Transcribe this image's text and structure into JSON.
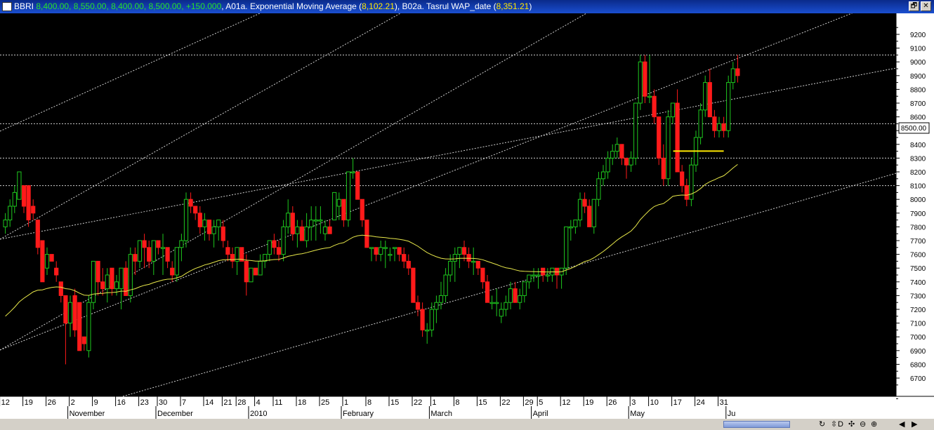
{
  "window": {
    "title_parts": [
      {
        "text": "BBRI",
        "color": "#ffffff"
      },
      {
        "text": " 8,400.00, 8,550.00, 8,400.00, 8,500.00, +150.000",
        "color": "#27e027"
      },
      {
        "text": ", A01a. Exponential Moving Average (",
        "color": "#ffffff"
      },
      {
        "text": "8,102.21",
        "color": "#ffe800"
      },
      {
        "text": "), B02a. Tasrul WAP_date (",
        "color": "#ffffff"
      },
      {
        "text": "8,351.21",
        "color": "#ffe800"
      },
      {
        "text": ")",
        "color": "#ffffff"
      }
    ],
    "buttons": [
      "🗗",
      "✕"
    ]
  },
  "toolbar": {
    "icons": [
      "refresh-icon",
      "resize-icon",
      "d-icon",
      "move-icon",
      "zoom-out-icon",
      "zoom-in-icon",
      "scroll-left-icon",
      "scroll-right-icon"
    ],
    "glyphs": [
      "↻",
      "⇳",
      "D",
      "✣",
      "⊖",
      "⊕",
      "◀",
      "▶"
    ]
  },
  "chart_data": {
    "type": "candlestick",
    "ticker": "BBRI",
    "ylim": [
      6500,
      9350
    ],
    "yticks": [
      6700,
      6800,
      6900,
      7000,
      7100,
      7200,
      7300,
      7400,
      7500,
      7600,
      7700,
      7800,
      7900,
      8000,
      8100,
      8200,
      8300,
      8400,
      8500,
      8600,
      8700,
      8800,
      8900,
      9000,
      9100,
      9200
    ],
    "last_price": "8500.00",
    "x_day_labels": [
      {
        "i": 0,
        "t": "12"
      },
      {
        "i": 5,
        "t": "19"
      },
      {
        "i": 10,
        "t": "26"
      },
      {
        "i": 15,
        "t": "2"
      },
      {
        "i": 20,
        "t": "9"
      },
      {
        "i": 25,
        "t": "16"
      },
      {
        "i": 30,
        "t": "23"
      },
      {
        "i": 34,
        "t": "30"
      },
      {
        "i": 39,
        "t": "7"
      },
      {
        "i": 44,
        "t": "14"
      },
      {
        "i": 48,
        "t": "21"
      },
      {
        "i": 51,
        "t": "28"
      },
      {
        "i": 55,
        "t": "4"
      },
      {
        "i": 59,
        "t": "11"
      },
      {
        "i": 64,
        "t": "18"
      },
      {
        "i": 69,
        "t": "25"
      },
      {
        "i": 74,
        "t": "1"
      },
      {
        "i": 79,
        "t": "8"
      },
      {
        "i": 84,
        "t": "15"
      },
      {
        "i": 89,
        "t": "22"
      },
      {
        "i": 93,
        "t": "1"
      },
      {
        "i": 98,
        "t": "8"
      },
      {
        "i": 103,
        "t": "15"
      },
      {
        "i": 108,
        "t": "22"
      },
      {
        "i": 113,
        "t": "29"
      },
      {
        "i": 116,
        "t": "5"
      },
      {
        "i": 121,
        "t": "12"
      },
      {
        "i": 126,
        "t": "19"
      },
      {
        "i": 131,
        "t": "26"
      },
      {
        "i": 136,
        "t": "3"
      },
      {
        "i": 140,
        "t": "10"
      },
      {
        "i": 145,
        "t": "17"
      },
      {
        "i": 150,
        "t": "24"
      },
      {
        "i": 155,
        "t": "31"
      }
    ],
    "x_month_labels": [
      {
        "i": 15,
        "t": "November"
      },
      {
        "i": 34,
        "t": "December"
      },
      {
        "i": 54,
        "t": "2010"
      },
      {
        "i": 74,
        "t": "February"
      },
      {
        "i": 93,
        "t": "March"
      },
      {
        "i": 115,
        "t": "April"
      },
      {
        "i": 136,
        "t": "May"
      },
      {
        "i": 157,
        "t": "Ju"
      }
    ],
    "candles": [
      [
        7800,
        7900,
        7750,
        7850
      ],
      [
        7850,
        8000,
        7800,
        7950
      ],
      [
        7950,
        8100,
        7900,
        8050
      ],
      [
        8000,
        8200,
        8000,
        8200
      ],
      [
        8100,
        8100,
        7900,
        7950
      ],
      [
        8100,
        8100,
        7800,
        7850
      ],
      [
        7950,
        8000,
        7850,
        7900
      ],
      [
        7850,
        7850,
        7600,
        7650
      ],
      [
        7700,
        7700,
        7400,
        7400
      ],
      [
        7500,
        7650,
        7450,
        7600
      ],
      [
        7600,
        7600,
        7550,
        7550
      ],
      [
        7500,
        7550,
        7400,
        7450
      ],
      [
        7400,
        7400,
        7250,
        7300
      ],
      [
        7300,
        7300,
        6800,
        7100
      ],
      [
        7100,
        7300,
        7000,
        7250
      ],
      [
        7300,
        7350,
        7000,
        7050
      ],
      [
        7250,
        7250,
        6900,
        6900
      ],
      [
        7000,
        7000,
        6900,
        6950
      ],
      [
        6900,
        7300,
        6850,
        7250
      ],
      [
        7250,
        7550,
        7200,
        7550
      ],
      [
        7550,
        7550,
        7300,
        7400
      ],
      [
        7400,
        7500,
        7300,
        7350
      ],
      [
        7350,
        7500,
        7250,
        7450
      ],
      [
        7500,
        7500,
        7300,
        7350
      ],
      [
        7350,
        7450,
        7300,
        7400
      ],
      [
        7350,
        7500,
        7200,
        7500
      ],
      [
        7500,
        7550,
        7300,
        7300
      ],
      [
        7300,
        7650,
        7250,
        7600
      ],
      [
        7600,
        7650,
        7450,
        7550
      ],
      [
        7550,
        7700,
        7500,
        7700
      ],
      [
        7700,
        7750,
        7500,
        7650
      ],
      [
        7650,
        7700,
        7500,
        7550
      ],
      [
        7550,
        7700,
        7450,
        7700
      ],
      [
        7700,
        7700,
        7600,
        7650
      ],
      [
        7650,
        7750,
        7450,
        7650
      ],
      [
        7650,
        7650,
        7500,
        7550
      ],
      [
        7500,
        7550,
        7400,
        7450
      ],
      [
        7450,
        7650,
        7400,
        7650
      ],
      [
        7650,
        7750,
        7550,
        7700
      ],
      [
        7700,
        8050,
        7650,
        8000
      ],
      [
        8000,
        8050,
        7900,
        7950
      ],
      [
        7950,
        7950,
        7850,
        7900
      ],
      [
        7900,
        7950,
        7750,
        7800
      ],
      [
        7800,
        7900,
        7700,
        7850
      ],
      [
        7850,
        7850,
        7700,
        7750
      ],
      [
        7750,
        7850,
        7650,
        7800
      ],
      [
        7800,
        7850,
        7700,
        7850
      ],
      [
        7800,
        7850,
        7650,
        7700
      ],
      [
        7650,
        7700,
        7550,
        7600
      ],
      [
        7600,
        7650,
        7500,
        7550
      ],
      [
        7550,
        7650,
        7450,
        7650
      ],
      [
        7650,
        7650,
        7550,
        7550
      ],
      [
        7550,
        7600,
        7300,
        7400
      ],
      [
        7400,
        7500,
        7400,
        7500
      ],
      [
        7500,
        7500,
        7450,
        7450
      ],
      [
        7450,
        7600,
        7450,
        7550
      ],
      [
        7550,
        7600,
        7500,
        7600
      ],
      [
        7600,
        7700,
        7550,
        7700
      ],
      [
        7700,
        7750,
        7600,
        7650
      ],
      [
        7650,
        7700,
        7550,
        7600
      ],
      [
        7600,
        7850,
        7550,
        7800
      ],
      [
        7800,
        8000,
        7750,
        7900
      ],
      [
        7900,
        7950,
        7700,
        7750
      ],
      [
        7750,
        7850,
        7650,
        7800
      ],
      [
        7800,
        7850,
        7700,
        7700
      ],
      [
        7700,
        7900,
        7650,
        7800
      ],
      [
        7800,
        7950,
        7700,
        7850
      ],
      [
        7850,
        7950,
        7700,
        7850
      ],
      [
        7850,
        7950,
        7750,
        7850
      ],
      [
        7750,
        7850,
        7700,
        7800
      ],
      [
        7800,
        7850,
        7750,
        7750
      ],
      [
        7850,
        8050,
        7850,
        8050
      ],
      [
        7950,
        8050,
        7850,
        8000
      ],
      [
        8000,
        8000,
        7800,
        7850
      ],
      [
        7850,
        8200,
        7800,
        8200
      ],
      [
        8200,
        8300,
        8150,
        8200
      ],
      [
        8200,
        8200,
        8000,
        8000
      ],
      [
        8000,
        8000,
        7800,
        7850
      ],
      [
        7850,
        7850,
        7650,
        7650
      ],
      [
        7650,
        7650,
        7550,
        7650
      ],
      [
        7650,
        7650,
        7550,
        7600
      ],
      [
        7600,
        7700,
        7550,
        7650
      ],
      [
        7650,
        7700,
        7500,
        7650
      ],
      [
        7600,
        7650,
        7550,
        7600
      ],
      [
        7650,
        7650,
        7550,
        7650
      ],
      [
        7650,
        7650,
        7550,
        7600
      ],
      [
        7600,
        7650,
        7500,
        7550
      ],
      [
        7550,
        7600,
        7450,
        7500
      ],
      [
        7500,
        7500,
        7300,
        7250
      ],
      [
        7250,
        7300,
        7150,
        7200
      ],
      [
        7200,
        7250,
        7000,
        7050
      ],
      [
        7050,
        7100,
        6950,
        7050
      ],
      [
        7050,
        7250,
        7000,
        7200
      ],
      [
        7200,
        7300,
        7100,
        7250
      ],
      [
        7250,
        7400,
        7200,
        7300
      ],
      [
        7300,
        7500,
        7250,
        7450
      ],
      [
        7450,
        7600,
        7400,
        7550
      ],
      [
        7550,
        7650,
        7400,
        7600
      ],
      [
        7600,
        7650,
        7500,
        7650
      ],
      [
        7650,
        7700,
        7550,
        7600
      ],
      [
        7600,
        7650,
        7500,
        7550
      ],
      [
        7550,
        7650,
        7450,
        7550
      ],
      [
        7550,
        7550,
        7450,
        7500
      ],
      [
        7500,
        7500,
        7350,
        7400
      ],
      [
        7400,
        7450,
        7250,
        7250
      ],
      [
        7250,
        7300,
        7200,
        7250
      ],
      [
        7250,
        7350,
        7150,
        7250
      ],
      [
        7150,
        7250,
        7100,
        7200
      ],
      [
        7200,
        7300,
        7150,
        7250
      ],
      [
        7250,
        7400,
        7200,
        7350
      ],
      [
        7350,
        7400,
        7250,
        7250
      ],
      [
        7250,
        7350,
        7200,
        7300
      ],
      [
        7300,
        7400,
        7250,
        7400
      ],
      [
        7400,
        7450,
        7350,
        7450
      ],
      [
        7450,
        7500,
        7400,
        7450
      ],
      [
        7450,
        7500,
        7350,
        7450
      ],
      [
        7500,
        7500,
        7400,
        7450
      ],
      [
        7450,
        7500,
        7400,
        7450
      ],
      [
        7450,
        7500,
        7400,
        7500
      ],
      [
        7500,
        7500,
        7350,
        7450
      ],
      [
        7450,
        7500,
        7350,
        7500
      ],
      [
        7500,
        7800,
        7450,
        7800
      ],
      [
        7800,
        7850,
        7700,
        7800
      ],
      [
        7800,
        7850,
        7750,
        7850
      ],
      [
        7850,
        8050,
        7800,
        8000
      ],
      [
        8000,
        8050,
        7900,
        7950
      ],
      [
        7950,
        8000,
        7800,
        7800
      ],
      [
        7800,
        8000,
        7750,
        8000
      ],
      [
        8000,
        8200,
        7950,
        8150
      ],
      [
        8150,
        8250,
        8100,
        8200
      ],
      [
        8200,
        8350,
        8150,
        8300
      ],
      [
        8300,
        8400,
        8250,
        8350
      ],
      [
        8350,
        8450,
        8300,
        8400
      ],
      [
        8400,
        8400,
        8250,
        8300
      ],
      [
        8300,
        8300,
        8150,
        8250
      ],
      [
        8250,
        8350,
        8200,
        8300
      ],
      [
        8300,
        8700,
        8250,
        8700
      ],
      [
        8700,
        9050,
        8650,
        9000
      ],
      [
        9000,
        9050,
        8700,
        8750
      ],
      [
        8750,
        9050,
        8700,
        8750
      ],
      [
        8750,
        8800,
        8550,
        8600
      ],
      [
        8600,
        8600,
        8250,
        8300
      ],
      [
        8300,
        8400,
        8100,
        8150
      ],
      [
        8150,
        8650,
        8100,
        8600
      ],
      [
        8600,
        8700,
        8550,
        8700
      ],
      [
        8700,
        8800,
        8200,
        8200
      ],
      [
        8200,
        8250,
        8050,
        8100
      ],
      [
        8100,
        8150,
        7950,
        8000
      ],
      [
        8000,
        8300,
        7950,
        8250
      ],
      [
        8250,
        8500,
        8200,
        8450
      ],
      [
        8450,
        8700,
        8400,
        8650
      ],
      [
        8650,
        8900,
        8600,
        8850
      ],
      [
        8850,
        8950,
        8600,
        8600
      ],
      [
        8600,
        8650,
        8450,
        8500
      ],
      [
        8500,
        8600,
        8450,
        8550
      ],
      [
        8550,
        8600,
        8450,
        8500
      ],
      [
        8500,
        8900,
        8450,
        8850
      ],
      [
        8850,
        9000,
        8800,
        8950
      ],
      [
        8950,
        9050,
        8850,
        8900
      ]
    ]
  }
}
